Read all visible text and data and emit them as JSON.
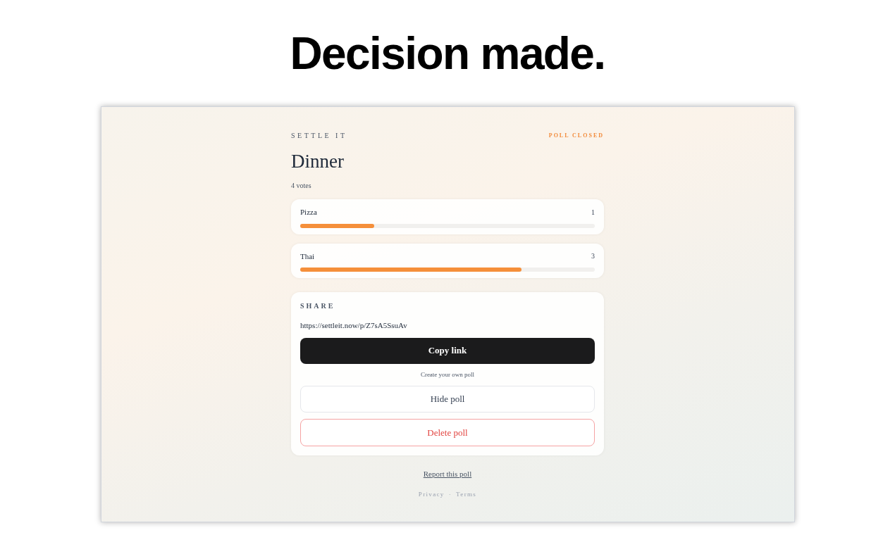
{
  "headline": "Decision made.",
  "page": {
    "brand": "SETTLE IT",
    "status": "POLL CLOSED",
    "title": "Dinner",
    "vote_count": "4 votes",
    "options": [
      {
        "label": "Pizza",
        "count": "1",
        "level": 0.25
      },
      {
        "label": "Thai",
        "count": "3",
        "level": 0.75
      }
    ],
    "share": {
      "heading": "SHARE",
      "url": "https://settleit.now/p/Z7sA5SsuAv",
      "copy_button": "Copy link",
      "create_link": "Create your own poll",
      "hide_button": "Hide poll",
      "delete_button": "Delete poll"
    },
    "report_link": "Report this poll",
    "footer": {
      "privacy": "Privacy",
      "separator": "·",
      "terms": "Terms"
    }
  }
}
